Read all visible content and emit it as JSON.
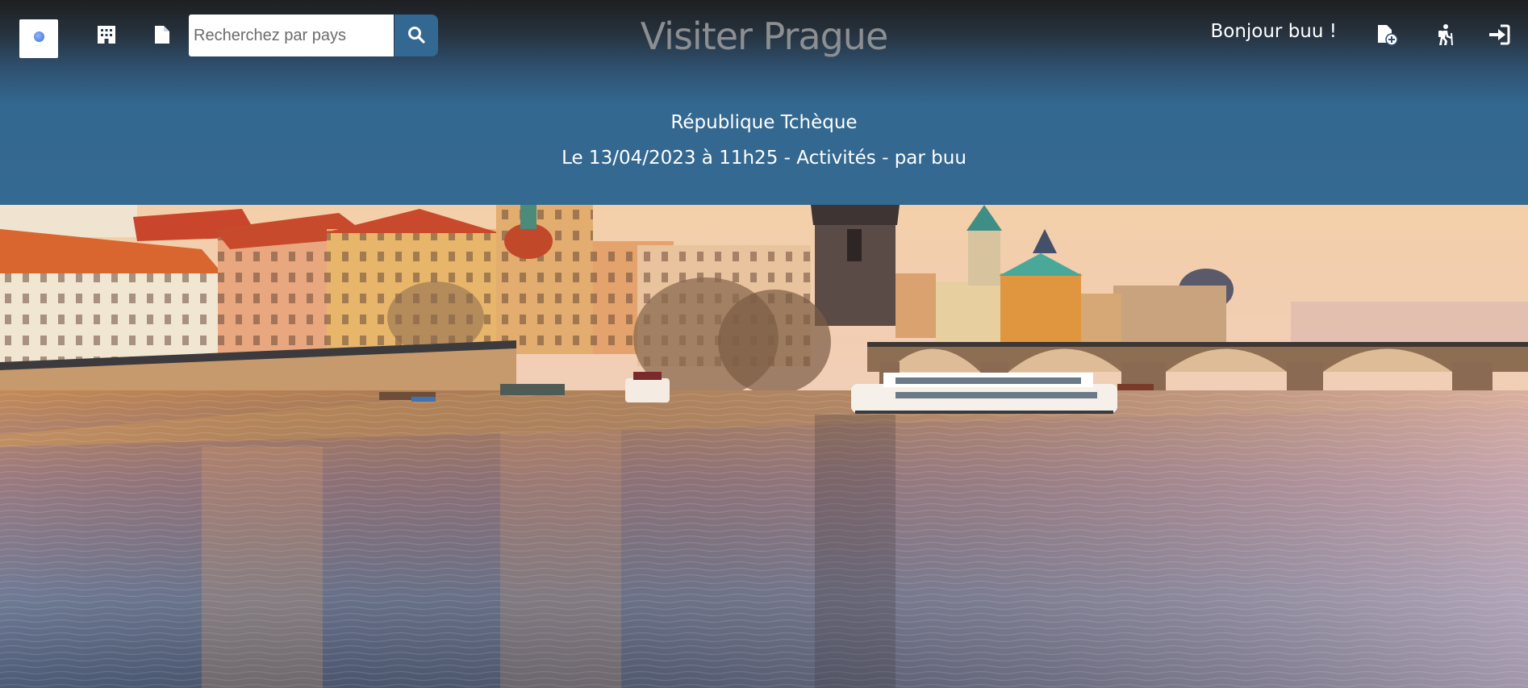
{
  "header": {
    "search": {
      "placeholder": "Recherchez par pays",
      "value": ""
    },
    "title": "Visiter Prague",
    "greeting": "Bonjour buu !",
    "icons": [
      "building-icon",
      "file-icon",
      "search-icon",
      "file-add-icon",
      "hiking-icon",
      "sign-in-icon"
    ]
  },
  "article": {
    "country": "République Tchèque",
    "meta": "Le 13/04/2023 à 11h25 - Activités - par buu"
  },
  "colors": {
    "header_top": "#1e1f21",
    "header_main": "#346992",
    "search_button": "#336892",
    "title": "#8c8f92"
  }
}
